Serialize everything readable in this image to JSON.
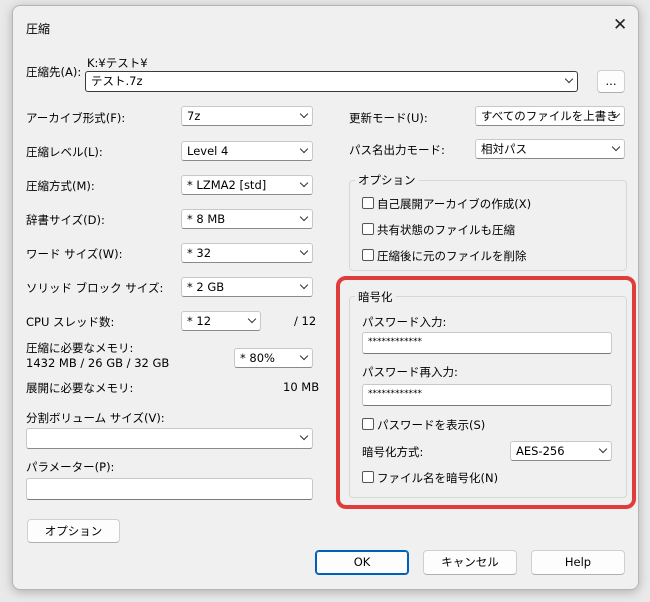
{
  "window": {
    "title": "圧縮"
  },
  "dest": {
    "label": "圧縮先(A):",
    "path": "K:¥テスト¥",
    "value": "テスト.7z",
    "browse_label": "..."
  },
  "left": {
    "archive_format": {
      "label": "アーカイブ形式(F):",
      "value": "7z"
    },
    "level": {
      "label": "圧縮レベル(L):",
      "value": "Level 4"
    },
    "method": {
      "label": "圧縮方式(M):",
      "value": "*  LZMA2 [std]"
    },
    "dict": {
      "label": "辞書サイズ(D):",
      "value": "*  8 MB"
    },
    "word": {
      "label": "ワード サイズ(W):",
      "value": "*  32"
    },
    "solid": {
      "label": "ソリッド ブロック サイズ:",
      "value": "*  2 GB"
    },
    "cpu": {
      "label": "CPU スレッド数:",
      "value": "*  12",
      "max": "/ 12"
    },
    "mem_compress": {
      "label": "圧縮に必要なメモリ:",
      "detail": "1432 MB / 26 GB / 32 GB",
      "value": "* 80%"
    },
    "mem_extract": {
      "label": "展開に必要なメモリ:",
      "value": "10 MB"
    },
    "split": {
      "label": "分割ボリューム サイズ(V):",
      "value": ""
    },
    "params": {
      "label": "パラメーター(P):",
      "value": ""
    }
  },
  "right": {
    "update_mode": {
      "label": "更新モード(U):",
      "value": "すべてのファイルを上書き"
    },
    "path_mode": {
      "label": "パス名出力モード:",
      "value": "相対パス"
    },
    "options": {
      "title": "オプション",
      "sfx": "自己展開アーカイブの作成(X)",
      "shared": "共有状態のファイルも圧縮",
      "delete_after": "圧縮後に元のファイルを削除"
    },
    "encryption": {
      "title": "暗号化",
      "password_label": "パスワード入力:",
      "password_value": "************",
      "reenter_label": "パスワード再入力:",
      "reenter_value": "************",
      "show_password": "パスワードを表示(S)",
      "method_label": "暗号化方式:",
      "method_value": "AES-256",
      "encrypt_names": "ファイル名を暗号化(N)"
    }
  },
  "buttons": {
    "options": "オプション",
    "ok": "OK",
    "cancel": "キャンセル",
    "help": "Help"
  },
  "colors": {
    "highlight": "#e03c3c",
    "primary_border": "#005fb8"
  }
}
